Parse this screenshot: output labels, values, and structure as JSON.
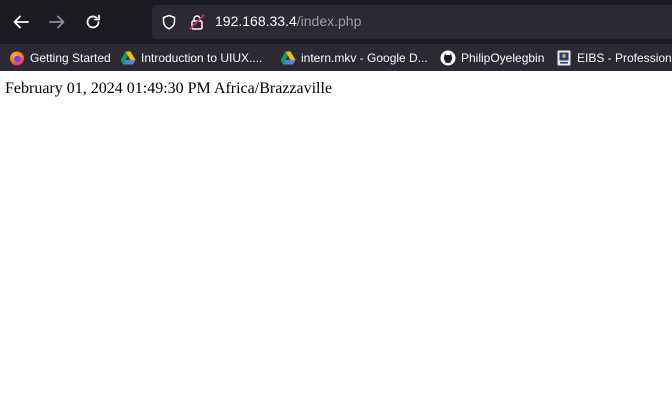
{
  "toolbar": {
    "back_icon": "back-arrow-icon",
    "forward_icon": "forward-arrow-icon",
    "reload_icon": "reload-icon",
    "shield_icon": "tracking-protection-shield-icon",
    "lock_icon": "insecure-lock-icon"
  },
  "url": {
    "host": "192.168.33.4",
    "path": "/index.php"
  },
  "bookmarks": [
    {
      "label": "Getting Started",
      "icon": "firefox-icon"
    },
    {
      "label": "Introduction to UIUX....",
      "icon": "google-drive-icon"
    },
    {
      "label": "intern.mkv - Google D...",
      "icon": "google-drive-icon"
    },
    {
      "label": "PhilipOyelegbin",
      "icon": "github-icon"
    },
    {
      "label": "EIBS - Professional",
      "icon": "eibs-icon"
    }
  ],
  "page": {
    "text": "February 01, 2024 01:49:30 PM Africa/Brazzaville"
  },
  "colors": {
    "toolbar_bg": "#1c1b22",
    "urlbar_bg": "#2b2a33",
    "bookmarks_bg": "#2b2a33",
    "text_light": "#fbfbfe",
    "url_path": "#9e9ea6",
    "page_bg": "#ffffff"
  }
}
